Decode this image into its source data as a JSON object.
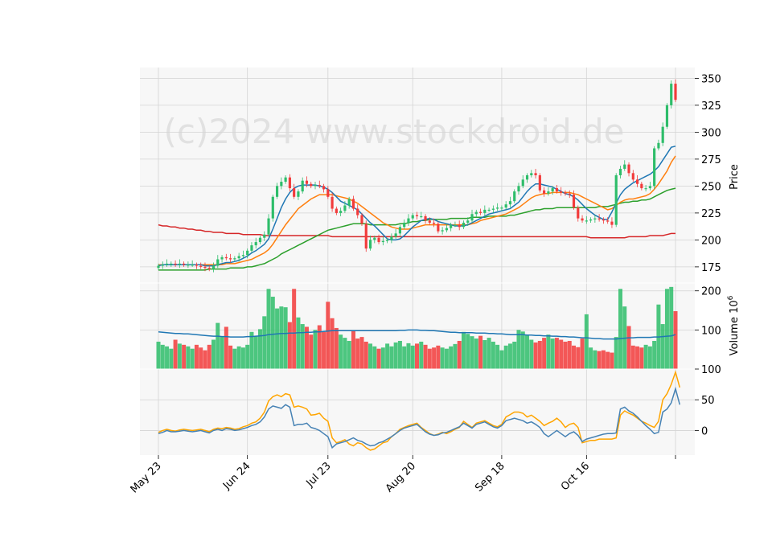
{
  "watermark": "(c)2024 www.stockdroid.de",
  "colors": {
    "up": "#2ebd6a",
    "down": "#f23b3b",
    "ma_short": "#1f77b4",
    "ma_mid": "#ff7f0e",
    "ma_long": "#2ca02c",
    "ma_longest": "#d62728",
    "vol_ma": "#1f77b4",
    "osc_a": "#ffa500",
    "osc_b": "#4682b4",
    "panel_bg": "#f7f7f7",
    "grid": "#d4d4d4"
  },
  "chart_data": [
    {
      "type": "candlestick",
      "panel": "price",
      "ylabel": "Price",
      "ylim": [
        160,
        360
      ],
      "yticks": [
        175,
        200,
        225,
        250,
        275,
        300,
        325,
        350
      ],
      "grid": true,
      "date_labels": [
        "May 23",
        "Jun 24",
        "Jul 23",
        "Aug 20",
        "Sep 18",
        "Oct 16"
      ],
      "date_label_index": [
        0,
        21,
        40,
        60,
        81,
        101
      ],
      "close": [
        176,
        177,
        178,
        178,
        177,
        178,
        177,
        177,
        177,
        176,
        175,
        174,
        173,
        176,
        182,
        184,
        183,
        182,
        183,
        185,
        186,
        190,
        195,
        198,
        202,
        205,
        220,
        240,
        250,
        254,
        258,
        248,
        240,
        245,
        255,
        252,
        250,
        251,
        250,
        247,
        240,
        229,
        225,
        227,
        232,
        238,
        229,
        223,
        215,
        192,
        200,
        202,
        198,
        199,
        200,
        203,
        206,
        212,
        216,
        220,
        223,
        222,
        222,
        218,
        216,
        215,
        208,
        209,
        211,
        214,
        214,
        212,
        216,
        218,
        224,
        226,
        225,
        228,
        228,
        229,
        230,
        230,
        233,
        236,
        245,
        250,
        256,
        260,
        262,
        260,
        246,
        243,
        245,
        248,
        245,
        244,
        243,
        242,
        230,
        220,
        218,
        218,
        219,
        220,
        219,
        218,
        217,
        214,
        260,
        266,
        270,
        262,
        256,
        252,
        248,
        248,
        250,
        285,
        290,
        305,
        325,
        345,
        330
      ],
      "ma_short": [
        176,
        177,
        177,
        177,
        177,
        177,
        177,
        177,
        177,
        177,
        177,
        176,
        176,
        176,
        177,
        178,
        179,
        179,
        180,
        181,
        183,
        185,
        188,
        190,
        193,
        196,
        201,
        210,
        220,
        230,
        238,
        244,
        248,
        250,
        251,
        251,
        251,
        251,
        250,
        249,
        247,
        244,
        240,
        236,
        234,
        232,
        230,
        228,
        224,
        220,
        216,
        213,
        209,
        205,
        201,
        200,
        200,
        201,
        204,
        208,
        212,
        215,
        218,
        219,
        220,
        219,
        217,
        216,
        215,
        214,
        213,
        213,
        213,
        214,
        216,
        218,
        220,
        222,
        224,
        225,
        226,
        227,
        228,
        229,
        232,
        235,
        240,
        245,
        249,
        252,
        252,
        251,
        250,
        249,
        247,
        245,
        243,
        242,
        240,
        237,
        233,
        229,
        226,
        223,
        221,
        219,
        219,
        226,
        234,
        242,
        247,
        250,
        253,
        255,
        257,
        259,
        261,
        264,
        268,
        274,
        280,
        286,
        287
      ],
      "ma_mid": [
        177,
        177,
        177,
        177,
        177,
        177,
        177,
        177,
        177,
        177,
        177,
        177,
        177,
        177,
        177,
        177,
        178,
        178,
        178,
        179,
        180,
        181,
        182,
        184,
        186,
        188,
        191,
        196,
        202,
        208,
        214,
        219,
        224,
        229,
        232,
        235,
        238,
        240,
        242,
        242,
        242,
        242,
        241,
        240,
        239,
        238,
        236,
        234,
        231,
        228,
        225,
        222,
        219,
        216,
        214,
        212,
        211,
        210,
        210,
        210,
        211,
        212,
        213,
        214,
        214,
        214,
        214,
        214,
        214,
        214,
        214,
        214,
        214,
        214,
        215,
        216,
        218,
        219,
        220,
        221,
        222,
        223,
        224,
        226,
        228,
        230,
        233,
        236,
        239,
        241,
        242,
        243,
        243,
        244,
        244,
        244,
        244,
        244,
        243,
        242,
        240,
        238,
        236,
        234,
        232,
        230,
        228,
        229,
        232,
        235,
        237,
        238,
        238,
        239,
        240,
        241,
        243,
        247,
        252,
        258,
        264,
        272,
        278
      ],
      "ma_long": [
        172,
        172,
        172,
        172,
        172,
        172,
        172,
        172,
        172,
        172,
        172,
        172,
        173,
        173,
        173,
        173,
        173,
        174,
        174,
        174,
        174,
        175,
        175,
        176,
        177,
        178,
        180,
        182,
        184,
        187,
        189,
        191,
        193,
        195,
        197,
        199,
        201,
        203,
        205,
        207,
        209,
        210,
        211,
        212,
        213,
        214,
        215,
        215,
        215,
        215,
        214,
        214,
        214,
        214,
        214,
        214,
        214,
        215,
        215,
        216,
        217,
        217,
        218,
        218,
        219,
        219,
        219,
        219,
        219,
        220,
        220,
        220,
        220,
        220,
        221,
        221,
        221,
        221,
        222,
        222,
        222,
        222,
        222,
        223,
        223,
        224,
        225,
        226,
        227,
        228,
        228,
        229,
        229,
        229,
        230,
        230,
        230,
        230,
        230,
        230,
        230,
        230,
        230,
        230,
        231,
        231,
        231,
        232,
        233,
        234,
        235,
        235,
        236,
        236,
        237,
        237,
        238,
        240,
        242,
        244,
        246,
        247,
        248
      ],
      "ma_longest": [
        214,
        213,
        213,
        212,
        212,
        211,
        211,
        210,
        210,
        209,
        209,
        208,
        208,
        207,
        207,
        207,
        206,
        206,
        206,
        206,
        205,
        205,
        205,
        205,
        205,
        204,
        204,
        204,
        204,
        204,
        204,
        204,
        204,
        204,
        204,
        204,
        204,
        204,
        204,
        204,
        204,
        203,
        203,
        203,
        203,
        203,
        203,
        203,
        203,
        203,
        203,
        203,
        203,
        203,
        203,
        203,
        203,
        203,
        203,
        203,
        203,
        203,
        203,
        203,
        203,
        203,
        203,
        203,
        203,
        203,
        203,
        203,
        203,
        203,
        203,
        203,
        203,
        203,
        203,
        203,
        203,
        203,
        203,
        203,
        203,
        203,
        203,
        203,
        203,
        203,
        203,
        203,
        203,
        203,
        203,
        203,
        203,
        203,
        203,
        203,
        203,
        203,
        202,
        202,
        202,
        202,
        202,
        202,
        202,
        202,
        202,
        203,
        203,
        203,
        203,
        203,
        204,
        204,
        204,
        204,
        205,
        206,
        206
      ]
    },
    {
      "type": "bar",
      "panel": "volume",
      "ylabel": "Volume  10",
      "ylabel_exponent": "6",
      "ylim": [
        0,
        220
      ],
      "yticks": [
        100,
        200
      ],
      "grid": true,
      "values": [
        70,
        62,
        58,
        52,
        75,
        65,
        62,
        58,
        52,
        62,
        55,
        48,
        62,
        75,
        118,
        82,
        108,
        60,
        52,
        58,
        55,
        62,
        95,
        85,
        102,
        135,
        205,
        185,
        155,
        160,
        158,
        120,
        205,
        132,
        115,
        108,
        88,
        100,
        112,
        95,
        172,
        130,
        105,
        88,
        80,
        72,
        98,
        78,
        82,
        70,
        65,
        58,
        52,
        55,
        65,
        58,
        68,
        72,
        58,
        66,
        60,
        65,
        70,
        62,
        52,
        55,
        60,
        55,
        52,
        58,
        64,
        72,
        95,
        90,
        84,
        78,
        85,
        74,
        80,
        70,
        62,
        48,
        60,
        65,
        70,
        100,
        96,
        88,
        75,
        68,
        72,
        80,
        88,
        78,
        80,
        75,
        70,
        72,
        60,
        56,
        78,
        140,
        55,
        48,
        46,
        48,
        44,
        42,
        82,
        205,
        160,
        110,
        60,
        58,
        55,
        62,
        58,
        72,
        165,
        115,
        205,
        210,
        148
      ],
      "ma": [
        95,
        94,
        93,
        92,
        91,
        91,
        90,
        90,
        89,
        88,
        87,
        86,
        85,
        84,
        84,
        83,
        83,
        82,
        82,
        82,
        82,
        83,
        83,
        84,
        85,
        86,
        88,
        89,
        90,
        91,
        91,
        92,
        92,
        93,
        93,
        94,
        94,
        95,
        95,
        96,
        97,
        98,
        98,
        98,
        98,
        98,
        98,
        98,
        98,
        98,
        98,
        98,
        98,
        98,
        98,
        98,
        98,
        99,
        99,
        100,
        100,
        100,
        99,
        99,
        98,
        98,
        97,
        96,
        95,
        94,
        94,
        93,
        93,
        93,
        93,
        92,
        92,
        92,
        91,
        91,
        90,
        90,
        89,
        88,
        88,
        88,
        88,
        87,
        87,
        86,
        86,
        85,
        85,
        84,
        84,
        83,
        83,
        82,
        82,
        81,
        80,
        80,
        79,
        78,
        78,
        77,
        77,
        77,
        77,
        78,
        79,
        80,
        80,
        81,
        81,
        81,
        81,
        82,
        82,
        83,
        84,
        85,
        88
      ]
    },
    {
      "type": "line",
      "panel": "indicator",
      "ylim": [
        -40,
        100
      ],
      "yticks": [
        0,
        50,
        100
      ],
      "grid": true,
      "series": [
        {
          "values": [
            -3,
            0,
            2,
            0,
            -1,
            1,
            2,
            1,
            0,
            1,
            2,
            0,
            -2,
            2,
            4,
            3,
            5,
            4,
            2,
            3,
            6,
            8,
            12,
            14,
            20,
            30,
            48,
            55,
            58,
            55,
            60,
            58,
            38,
            40,
            38,
            35,
            25,
            26,
            28,
            20,
            15,
            -12,
            -20,
            -18,
            -15,
            -22,
            -25,
            -20,
            -22,
            -28,
            -32,
            -30,
            -25,
            -20,
            -18,
            -10,
            -5,
            2,
            5,
            8,
            10,
            12,
            5,
            0,
            -5,
            -8,
            -6,
            -3,
            -5,
            -2,
            2,
            5,
            15,
            10,
            5,
            12,
            14,
            16,
            12,
            8,
            6,
            10,
            22,
            26,
            30,
            30,
            28,
            22,
            25,
            20,
            15,
            8,
            12,
            15,
            20,
            14,
            5,
            10,
            12,
            5,
            -20,
            -18,
            -16,
            -16,
            -14,
            -14,
            -14,
            -14,
            -12,
            25,
            32,
            28,
            25,
            20,
            15,
            12,
            8,
            5,
            15,
            50,
            60,
            75,
            95,
            70
          ]
        },
        {
          "values": [
            -5,
            -3,
            0,
            -2,
            -2,
            -1,
            0,
            -1,
            -2,
            -1,
            0,
            -2,
            -4,
            0,
            2,
            0,
            3,
            2,
            0,
            1,
            3,
            5,
            8,
            10,
            14,
            22,
            35,
            40,
            38,
            36,
            42,
            38,
            8,
            10,
            10,
            12,
            5,
            3,
            0,
            -5,
            -10,
            -28,
            -22,
            -20,
            -18,
            -15,
            -12,
            -16,
            -18,
            -22,
            -25,
            -24,
            -20,
            -18,
            -14,
            -10,
            -5,
            0,
            4,
            6,
            8,
            10,
            4,
            -2,
            -6,
            -8,
            -7,
            -4,
            -3,
            0,
            3,
            6,
            12,
            8,
            4,
            10,
            12,
            14,
            10,
            6,
            4,
            8,
            16,
            18,
            20,
            18,
            16,
            12,
            14,
            10,
            5,
            -5,
            -10,
            -5,
            0,
            -5,
            -10,
            -5,
            -2,
            -8,
            -18,
            -14,
            -12,
            -10,
            -8,
            -6,
            -5,
            -5,
            -4,
            35,
            38,
            32,
            28,
            22,
            15,
            8,
            2,
            -5,
            -3,
            30,
            35,
            45,
            68,
            42
          ]
        }
      ]
    }
  ]
}
